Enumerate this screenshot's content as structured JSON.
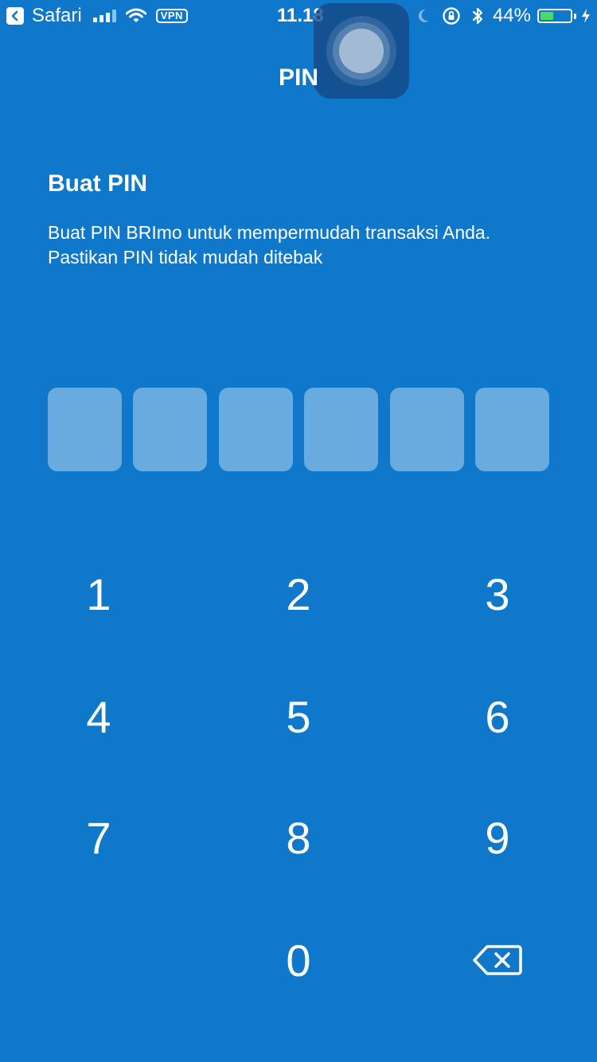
{
  "status_bar": {
    "back_app": "Safari",
    "vpn": "VPN",
    "time": "11.18",
    "battery_percent": "44%",
    "battery_level": 0.44,
    "battery_color": "#4cd964"
  },
  "nav": {
    "title": "PIN"
  },
  "main": {
    "heading": "Buat PIN",
    "description_line1": "Buat PIN BRImo untuk mempermudah transaksi Anda.",
    "description_line2": "Pastikan PIN tidak mudah ditebak",
    "pin_length": 6
  },
  "keypad": {
    "keys": [
      "1",
      "2",
      "3",
      "4",
      "5",
      "6",
      "7",
      "8",
      "9",
      "0"
    ],
    "backspace_icon": "backspace-icon"
  },
  "theme": {
    "background": "#0f78cb",
    "text": "#ffffff"
  }
}
